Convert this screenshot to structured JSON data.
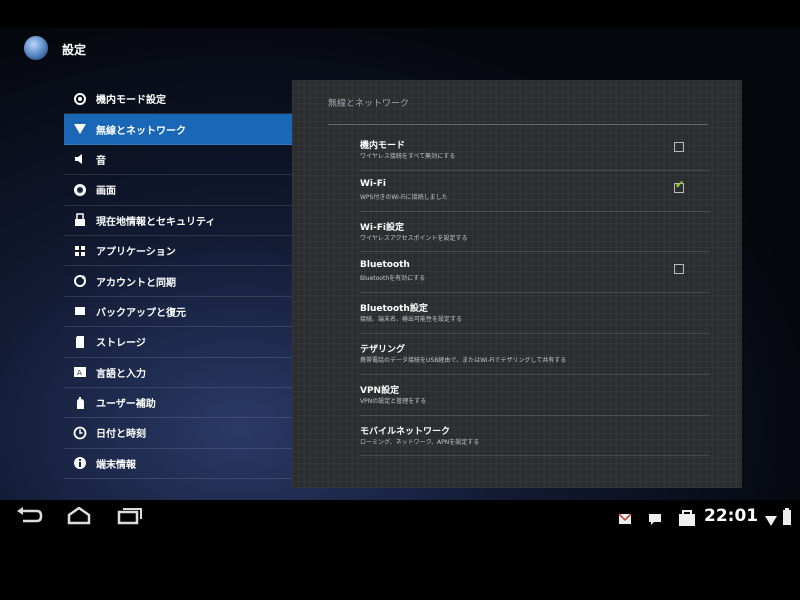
{
  "app": {
    "title": "設定",
    "icon": "settings-app-icon"
  },
  "sidebar": {
    "items": [
      {
        "label": "機内モード設定",
        "icon": "gear-icon"
      },
      {
        "label": "無線とネットワーク",
        "icon": "wifi-icon"
      },
      {
        "label": "音",
        "icon": "speaker-icon"
      },
      {
        "label": "画面",
        "icon": "brightness-icon"
      },
      {
        "label": "現在地情報とセキュリティ",
        "icon": "lock-icon"
      },
      {
        "label": "アプリケーション",
        "icon": "apps-icon"
      },
      {
        "label": "アカウントと同期",
        "icon": "sync-icon"
      },
      {
        "label": "バックアップと復元",
        "icon": "backup-icon"
      },
      {
        "label": "ストレージ",
        "icon": "storage-icon"
      },
      {
        "label": "言語と入力",
        "icon": "keyboard-icon"
      },
      {
        "label": "ユーザー補助",
        "icon": "hand-icon"
      },
      {
        "label": "日付と時刻",
        "icon": "clock-icon"
      },
      {
        "label": "端末情報",
        "icon": "info-icon"
      }
    ],
    "active_index": 1
  },
  "panel": {
    "header": "無線とネットワーク",
    "rows": [
      {
        "title": "機内モード",
        "subtitle": "ワイヤレス接続をすべて無効にする",
        "checkbox": true,
        "checked": false
      },
      {
        "title": "Wi-Fi",
        "subtitle": "WPS付きのWi-Fiに接続しました",
        "checkbox": true,
        "checked": true
      },
      {
        "title": "Wi-Fi設定",
        "subtitle": "ワイヤレスアクセスポイントを設定する",
        "checkbox": false
      },
      {
        "title": "Bluetooth",
        "subtitle": "Bluetoothを有効にする",
        "checkbox": true,
        "checked": false
      },
      {
        "title": "Bluetooth設定",
        "subtitle": "接続、端末名、検出可能性を設定する",
        "checkbox": false
      },
      {
        "title": "テザリング",
        "subtitle": "携帯電話のデータ接続をUSB経由で、またはWi-Fiでテザリングして共有する",
        "checkbox": false
      },
      {
        "title": "VPN設定",
        "subtitle": "VPNの設定と管理をする",
        "checkbox": false
      },
      {
        "title": "モバイルネットワーク",
        "subtitle": "ローミング、ネットワーク、APNを設定する",
        "checkbox": false
      }
    ]
  },
  "status_bar": {
    "clock": "22:01",
    "icons": [
      "mail-icon",
      "chat-icon",
      "bag-icon",
      "wifi-signal-icon",
      "battery-icon"
    ]
  },
  "nav_bar": {
    "buttons": [
      "back-button",
      "home-button",
      "recent-apps-button"
    ]
  },
  "colors": {
    "accent": "#1b67b7",
    "panel_bg": "#2b2d2f",
    "check_green": "#8fd22e"
  }
}
